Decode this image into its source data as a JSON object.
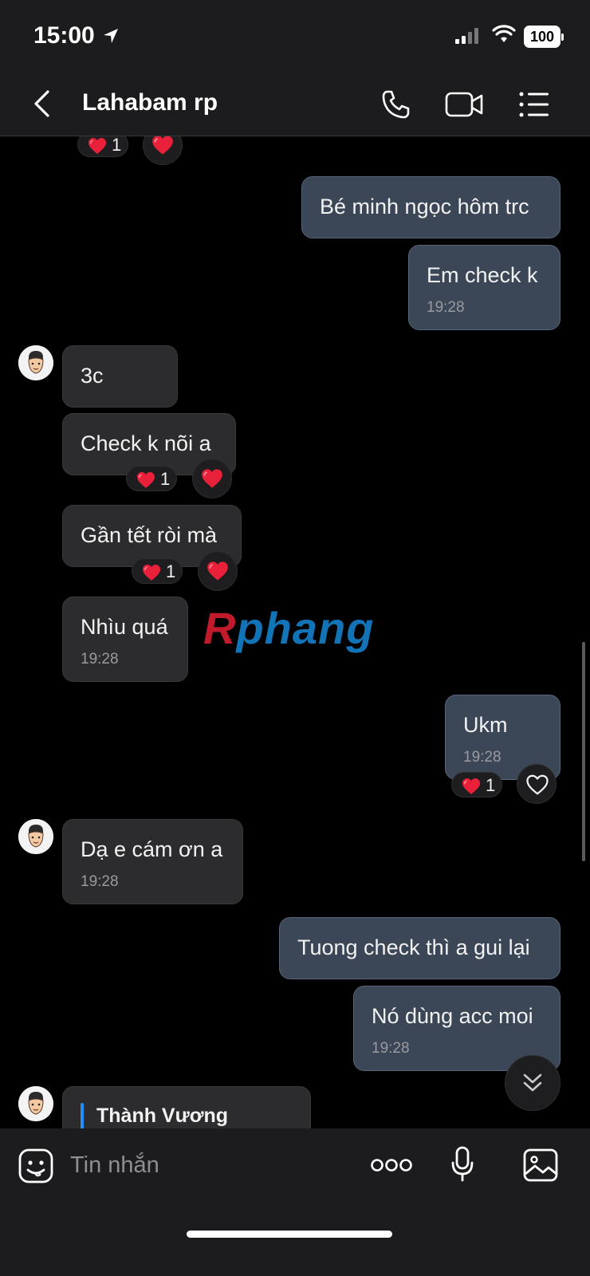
{
  "status": {
    "time": "15:00",
    "battery": "100"
  },
  "header": {
    "title": "Lahabam rp"
  },
  "messages": [
    {
      "text": "Bé minh ngọc hôm trc"
    },
    {
      "text": "Em check k",
      "time": "19:28"
    },
    {
      "text": "3c"
    },
    {
      "text": "Check k nõi a",
      "reaction_count": "1"
    },
    {
      "text": "Gần tết ròi mà",
      "reaction_count": "1"
    },
    {
      "text": "Nhìu quá",
      "time": "19:28"
    },
    {
      "text": "Ukm",
      "time": "19:28",
      "reaction_count": "1"
    },
    {
      "text": "Dạ e cám ơn a",
      "time": "19:28"
    },
    {
      "text": "Tuong check thì a gui lại"
    },
    {
      "text": "Nó dùng acc moi",
      "time": "19:28"
    }
  ],
  "top_reaction_count": "1",
  "quoted_reply": {
    "sender": "Thành Vương"
  },
  "watermark": {
    "part1": "R",
    "part2": "phang"
  },
  "composer": {
    "placeholder": "Tin nhắn"
  },
  "colors": {
    "incoming": "#2c2c2e",
    "outgoing": "#3b4656",
    "reply_bar": "#1f8fff",
    "heart": "#e8203a"
  }
}
